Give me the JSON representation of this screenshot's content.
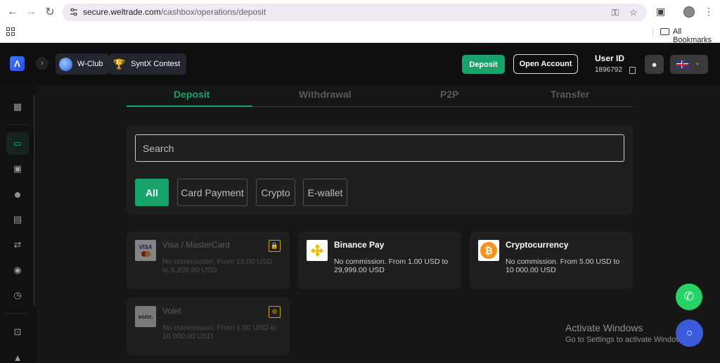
{
  "browser": {
    "url_host": "secure.weltrade.com",
    "url_path": "/cashbox/operations/deposit",
    "bookmarks_label": "All Bookmarks"
  },
  "header": {
    "wclub_label": "W-Club",
    "contest_label": "SyntX Contest",
    "deposit_button": "Deposit",
    "open_account_button": "Open Account",
    "user_id_label": "User ID",
    "user_id_value": "1896792"
  },
  "sidebar": {
    "items": [
      "dashboard-icon",
      "deposit-icon",
      "wallet-icon",
      "partners-icon",
      "cards-icon",
      "transfer-icon",
      "cashback-icon",
      "history-icon",
      "terminal-icon",
      "chart-icon"
    ],
    "active": "deposit-icon"
  },
  "tabs": [
    {
      "label": "Deposit",
      "active": true
    },
    {
      "label": "Withdrawal",
      "active": false
    },
    {
      "label": "P2P",
      "active": false
    },
    {
      "label": "Transfer",
      "active": false
    }
  ],
  "search": {
    "placeholder": "Search"
  },
  "filters": [
    {
      "label": "All",
      "active": true
    },
    {
      "label": "Card Payment",
      "active": false
    },
    {
      "label": "Crypto",
      "active": false
    },
    {
      "label": "E-wallet",
      "active": false
    }
  ],
  "methods": [
    {
      "title": "Visa / MasterCard",
      "desc": "No commission. From 10.00 USD to 5,200.00 USD",
      "disabled": true,
      "badge": "lock-icon"
    },
    {
      "title": "Binance Pay",
      "desc": "No commission. From 1.00 USD to 29,999.00 USD",
      "disabled": false
    },
    {
      "title": "Cryptocurrency",
      "desc": "No commission. From 5.00 USD to 10 000.00 USD",
      "disabled": false
    },
    {
      "title": "Volet",
      "desc": "No commission. From 1.00 USD to 10 000.00 USD",
      "disabled": true,
      "badge": "gear-badge-icon",
      "logo_text": "vo/et."
    }
  ],
  "windows_notice": {
    "title": "Activate Windows",
    "subtitle": "Go to Settings to activate Windows."
  },
  "colors": {
    "accent": "#17a36b",
    "background": "#161616",
    "card": "#1f1f1f",
    "badge": "#d79b1b"
  }
}
